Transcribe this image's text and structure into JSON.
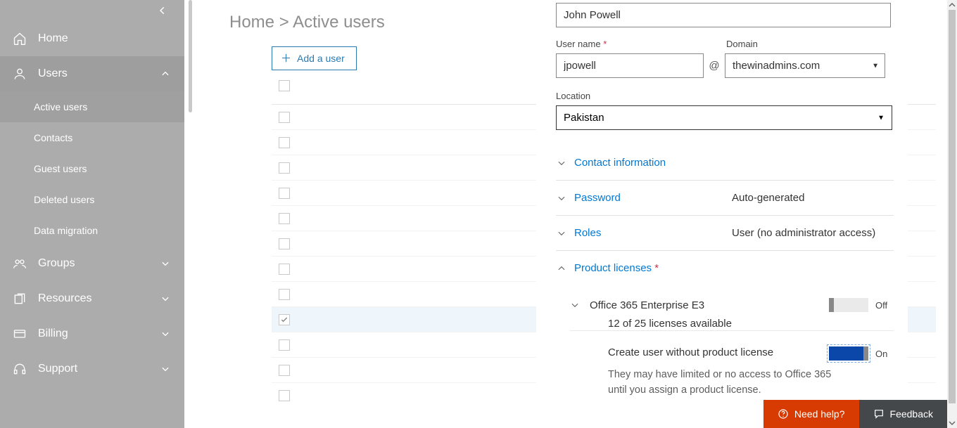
{
  "sidebar": {
    "items": {
      "home": "Home",
      "users": "Users",
      "groups": "Groups",
      "resources": "Resources",
      "billing": "Billing",
      "support": "Support"
    },
    "users_sub": {
      "active": "Active users",
      "contacts": "Contacts",
      "guest": "Guest users",
      "deleted": "Deleted users",
      "migration": "Data migration"
    }
  },
  "breadcrumb": {
    "home": "Home",
    "sep": " > ",
    "current": "Active users"
  },
  "toolbar": {
    "add_user": "Add a user"
  },
  "panel": {
    "display_name_value": "John Powell",
    "username_label": "User name",
    "username_value": "jpowell",
    "domain_label": "Domain",
    "domain_value": "thewinadmins.com",
    "at": "@",
    "location_label": "Location",
    "location_value": "Pakistan",
    "sections": {
      "contact": "Contact information",
      "password": "Password",
      "password_value": "Auto-generated",
      "roles": "Roles",
      "roles_value": "User (no administrator access)",
      "product_licenses": "Product licenses"
    },
    "license": {
      "name": "Office 365 Enterprise E3",
      "availability": "12 of 25 licenses available",
      "off_label": "Off",
      "no_license_label": "Create user without product license",
      "on_label": "On",
      "no_license_desc": "They may have limited or no access to Office 365 until you assign a product license."
    }
  },
  "footer": {
    "help": "Need help?",
    "feedback": "Feedback"
  }
}
